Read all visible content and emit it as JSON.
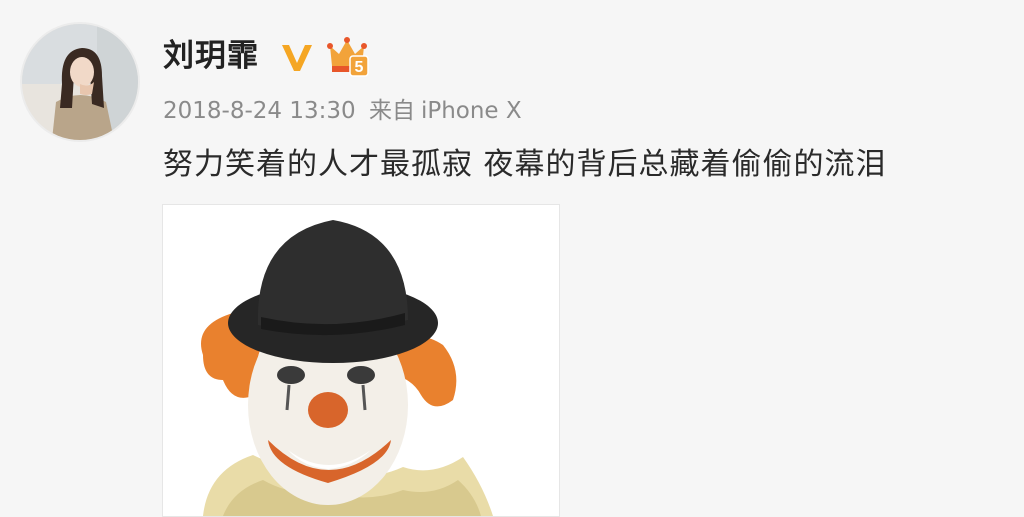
{
  "post": {
    "user_name": "刘玥霏",
    "timestamp": "2018-8-24 13:30",
    "source_prefix": "来自",
    "source_device": "iPhone X",
    "text": "努力笑着的人才最孤寂  夜幕的背后总藏着偷偷的流泪"
  },
  "icons": {
    "verified": "verified-v-icon",
    "member": "crown-member-icon"
  },
  "colors": {
    "verified_badge": "#f5a623",
    "member_badge": "#f2a33a",
    "name_text": "#222222",
    "meta_text": "#8a8a8a"
  }
}
